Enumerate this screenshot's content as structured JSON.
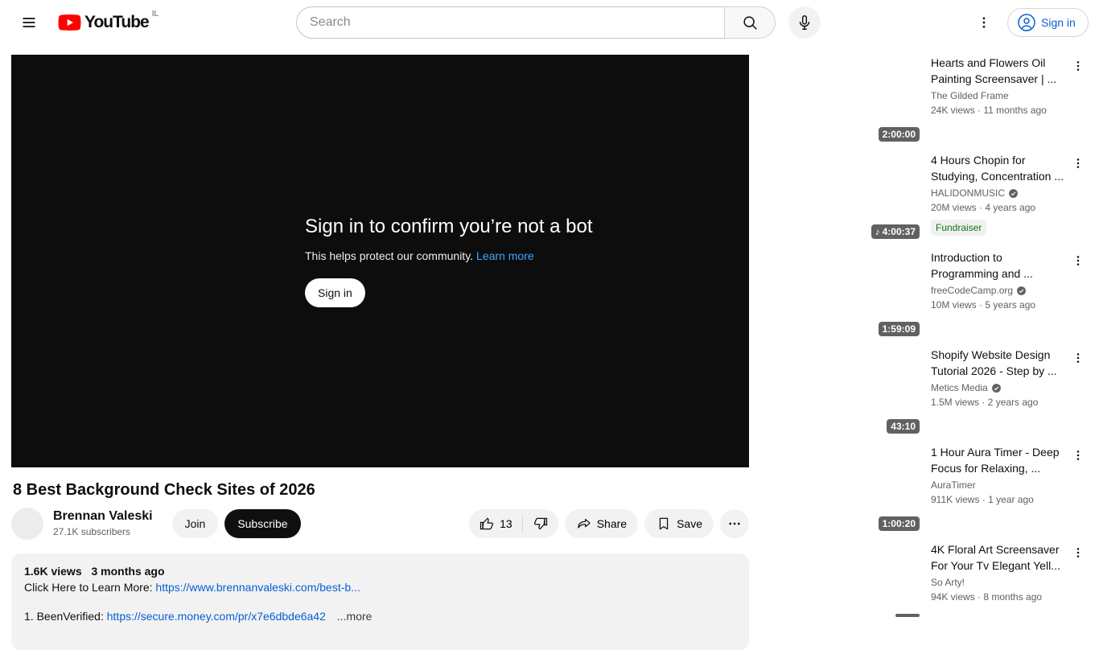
{
  "header": {
    "logo_text": "YouTube",
    "country_code": "IL",
    "search_placeholder": "Search",
    "signin_label": "Sign in"
  },
  "player": {
    "title": "Sign in to confirm you’re not a bot",
    "subtitle": "This helps protect our community.",
    "learn_more_label": "Learn more",
    "signin_label": "Sign in"
  },
  "video": {
    "title": "8 Best Background Check Sites of 2026",
    "channel_name": "Brennan Valeski",
    "channel_subscribers": "27.1K subscribers",
    "join_label": "Join",
    "subscribe_label": "Subscribe",
    "like_count": "13",
    "share_label": "Share",
    "save_label": "Save",
    "description": {
      "views": "1.6K views",
      "age": "3 months ago",
      "line1_prefix": "Click Here to Learn More: ",
      "line1_link": "https://www.brennanvaleski.com/best-b...",
      "line2_prefix": "1. BeenVerified: ",
      "line2_link": "https://secure.money.com/pr/x7e6dbde6a42",
      "more_label": "...more"
    }
  },
  "sidebar": {
    "items": [
      {
        "title": "Hearts and Flowers Oil Painting Screensaver | ...",
        "channel": "The Gilded Frame",
        "verified": false,
        "meta": "24K views · 11 months ago",
        "duration": "2:00:00",
        "music_icon": "",
        "badge": ""
      },
      {
        "title": "4 Hours Chopin for Studying, Concentration ...",
        "channel": "HALIDONMUSIC",
        "verified": true,
        "meta": "20M views · 4 years ago",
        "duration": "4:00:37",
        "music_icon": "♪",
        "badge": "Fundraiser"
      },
      {
        "title": "Introduction to Programming and ...",
        "channel": "freeCodeCamp.org",
        "verified": true,
        "meta": "10M views · 5 years ago",
        "duration": "1:59:09",
        "music_icon": "",
        "badge": ""
      },
      {
        "title": "Shopify Website Design Tutorial 2026 - Step by ...",
        "channel": "Metics Media",
        "verified": true,
        "meta": "1.5M views · 2 years ago",
        "duration": "43:10",
        "music_icon": "",
        "badge": ""
      },
      {
        "title": "1 Hour Aura Timer - Deep Focus for Relaxing, ...",
        "channel": "AuraTimer",
        "verified": false,
        "meta": "911K views · 1 year ago",
        "duration": "1:00:20",
        "music_icon": "",
        "badge": ""
      },
      {
        "title": "4K Floral Art Screensaver For Your Tv Elegant Yell...",
        "channel": "So Arty!",
        "verified": false,
        "meta": "94K views · 8 months ago",
        "duration": "",
        "music_icon": "",
        "badge": ""
      }
    ]
  },
  "colors": {
    "brand_red": "#ff0000",
    "link_blue": "#065fd4",
    "player_link_blue": "#3ea6ff",
    "fundraiser_green": "#107516",
    "muted_text": "#606060"
  }
}
